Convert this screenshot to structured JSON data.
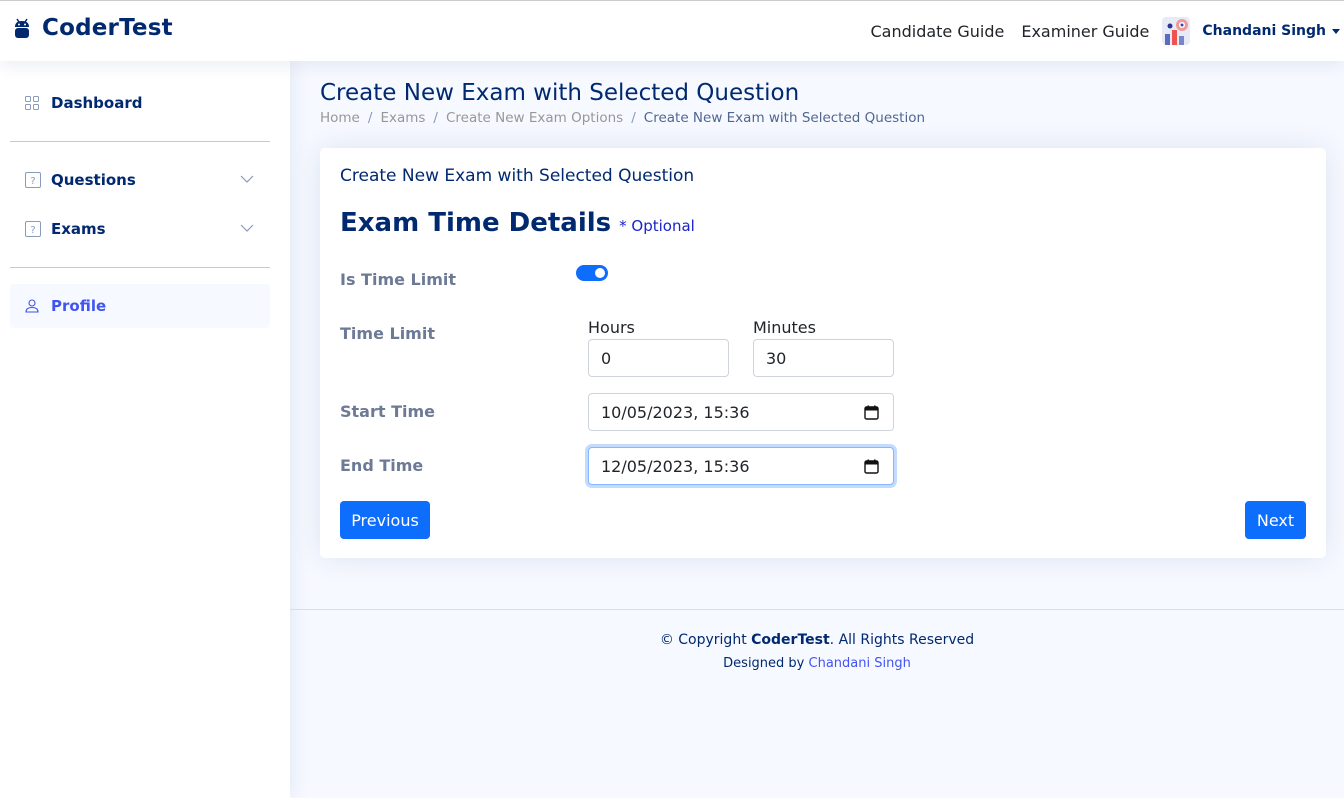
{
  "app": {
    "name": "CoderTest"
  },
  "header": {
    "links": [
      "Candidate Guide",
      "Examiner Guide"
    ],
    "user_name": "Chandani Singh"
  },
  "sidebar": {
    "items": [
      {
        "label": "Dashboard",
        "icon": "grid-icon"
      },
      {
        "label": "Questions",
        "icon": "question-icon"
      },
      {
        "label": "Exams",
        "icon": "question-icon"
      },
      {
        "label": "Profile",
        "icon": "person-icon"
      }
    ]
  },
  "page": {
    "title": "Create New Exam with Selected Question",
    "breadcrumb": [
      "Home",
      "Exams",
      "Create New Exam Options",
      "Create New Exam with Selected Question"
    ]
  },
  "card": {
    "title": "Create New Exam with Selected Question",
    "section_title": "Exam Time Details",
    "optional_note": "* Optional",
    "labels": {
      "is_time_limit": "Is Time Limit",
      "time_limit": "Time Limit",
      "start_time": "Start Time",
      "end_time": "End Time",
      "hours": "Hours",
      "minutes": "Minutes"
    },
    "values": {
      "time_limit_enabled": true,
      "hours": "0",
      "minutes": "30",
      "start_time": "10/05/2023, 15:36",
      "end_time": "12/05/2023, 15:36"
    },
    "buttons": {
      "previous": "Previous",
      "next": "Next"
    }
  },
  "footer": {
    "copyright_prefix": "© Copyright ",
    "copyright_brand": "CoderTest",
    "copyright_suffix": ". All Rights Reserved",
    "designed_by": "Designed by ",
    "designer": "Chandani Singh"
  },
  "colors": {
    "primary": "#0d6efd",
    "navy": "#012970",
    "accent": "#4154f1"
  }
}
